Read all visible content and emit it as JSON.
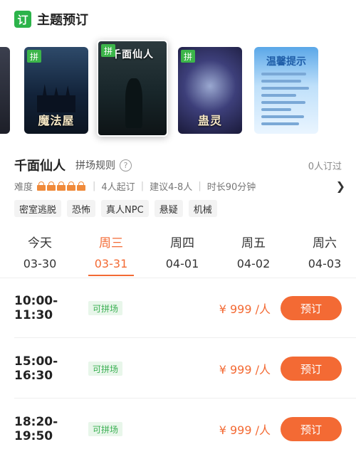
{
  "header": {
    "icon_text": "订",
    "title": "主题预订"
  },
  "posters": [
    {
      "badge": "",
      "title": ""
    },
    {
      "badge": "拼",
      "title": "魔法屋"
    },
    {
      "badge": "拼",
      "title": "千面仙人"
    },
    {
      "badge": "拼",
      "title": "蛊灵"
    },
    {
      "badge": "",
      "title": "温馨提示"
    }
  ],
  "game": {
    "title": "千面仙人",
    "rules_label": "拼场规则",
    "help_icon": "?",
    "booked_text": "0人订过",
    "difficulty_label": "难度",
    "difficulty_level": 5,
    "min_players": "4人起订",
    "suggested": "建议4-8人",
    "duration": "时长90分钟",
    "more_icon": "chevron-right-icon"
  },
  "tags": [
    "密室逃脱",
    "恐怖",
    "真人NPC",
    "悬疑",
    "机械"
  ],
  "dates": [
    {
      "name": "今天",
      "date": "03-30"
    },
    {
      "name": "周三",
      "date": "03-31",
      "active": true
    },
    {
      "name": "周四",
      "date": "04-01"
    },
    {
      "name": "周五",
      "date": "04-02"
    },
    {
      "name": "周六",
      "date": "04-03"
    }
  ],
  "slots": [
    {
      "time": "10:00-11:30",
      "badge": "可拼场",
      "price": "¥ 999 /人",
      "button": "预订"
    },
    {
      "time": "15:00-16:30",
      "badge": "可拼场",
      "price": "¥ 999 /人",
      "button": "预订"
    },
    {
      "time": "18:20-19:50",
      "badge": "可拼场",
      "price": "¥ 999 /人",
      "button": "预订"
    }
  ],
  "colors": {
    "accent": "#f36a34",
    "green": "#2cb34a"
  }
}
